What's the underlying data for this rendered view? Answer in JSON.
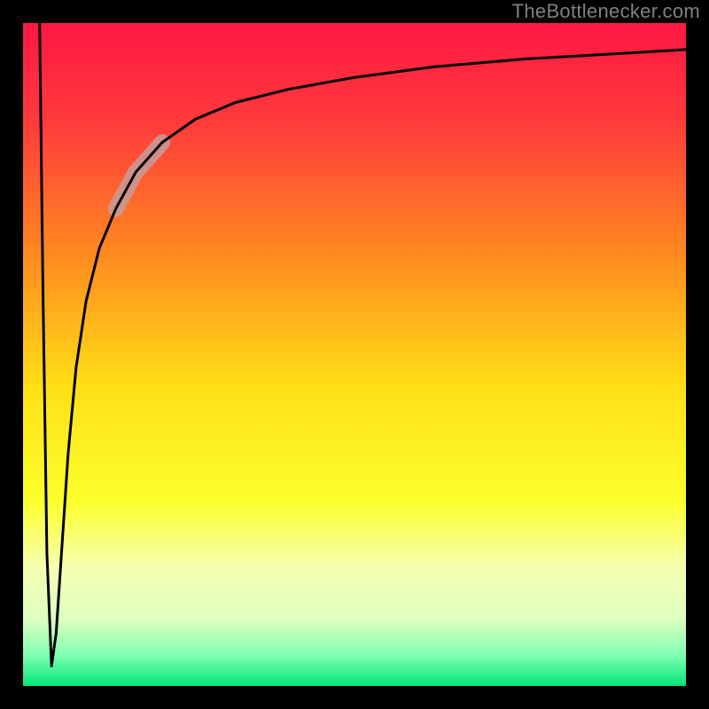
{
  "watermark": "TheBottlenecker.com",
  "chart_data": {
    "type": "line",
    "title": "",
    "xlabel": "",
    "ylabel": "",
    "xlim": [
      0,
      100
    ],
    "ylim": [
      0,
      100
    ],
    "grid": false,
    "attribution": "TheBottlenecker.com",
    "note": "No axis ticks or numeric labels are rendered in the image; x/y values are normalized 0–100 estimates of the curve shape read from pixel positions.",
    "background": {
      "type": "vertical-gradient",
      "stops": [
        {
          "offset": 0.0,
          "color": "#ff1744"
        },
        {
          "offset": 0.15,
          "color": "#ff3b3b"
        },
        {
          "offset": 0.35,
          "color": "#ff8a1f"
        },
        {
          "offset": 0.55,
          "color": "#ffe016"
        },
        {
          "offset": 0.72,
          "color": "#fbff2a"
        },
        {
          "offset": 0.82,
          "color": "#f6ffb0"
        },
        {
          "offset": 0.9,
          "color": "#dcffc0"
        },
        {
          "offset": 0.955,
          "color": "#7cffb0"
        },
        {
          "offset": 1.0,
          "color": "#00e676"
        }
      ]
    },
    "series": [
      {
        "name": "curve",
        "x": [
          2.5,
          3.0,
          3.6,
          4.3,
          5.0,
          5.8,
          6.8,
          8.0,
          9.5,
          11.5,
          14.0,
          17.0,
          21.0,
          26.0,
          32.0,
          40.0,
          50.0,
          62.0,
          76.0,
          90.0,
          100.0
        ],
        "y": [
          100.0,
          60.0,
          20.0,
          3.0,
          8.0,
          20.0,
          35.0,
          48.0,
          58.0,
          66.0,
          72.0,
          77.5,
          82.0,
          85.5,
          88.0,
          90.0,
          91.8,
          93.4,
          94.6,
          95.4,
          96.0
        ]
      }
    ],
    "highlight": {
      "color": "#c79b9b",
      "x": [
        14.0,
        17.0,
        21.0
      ],
      "y": [
        72.0,
        77.5,
        82.0
      ]
    },
    "frame": {
      "color": "#000000",
      "thickness_px": 26
    }
  }
}
